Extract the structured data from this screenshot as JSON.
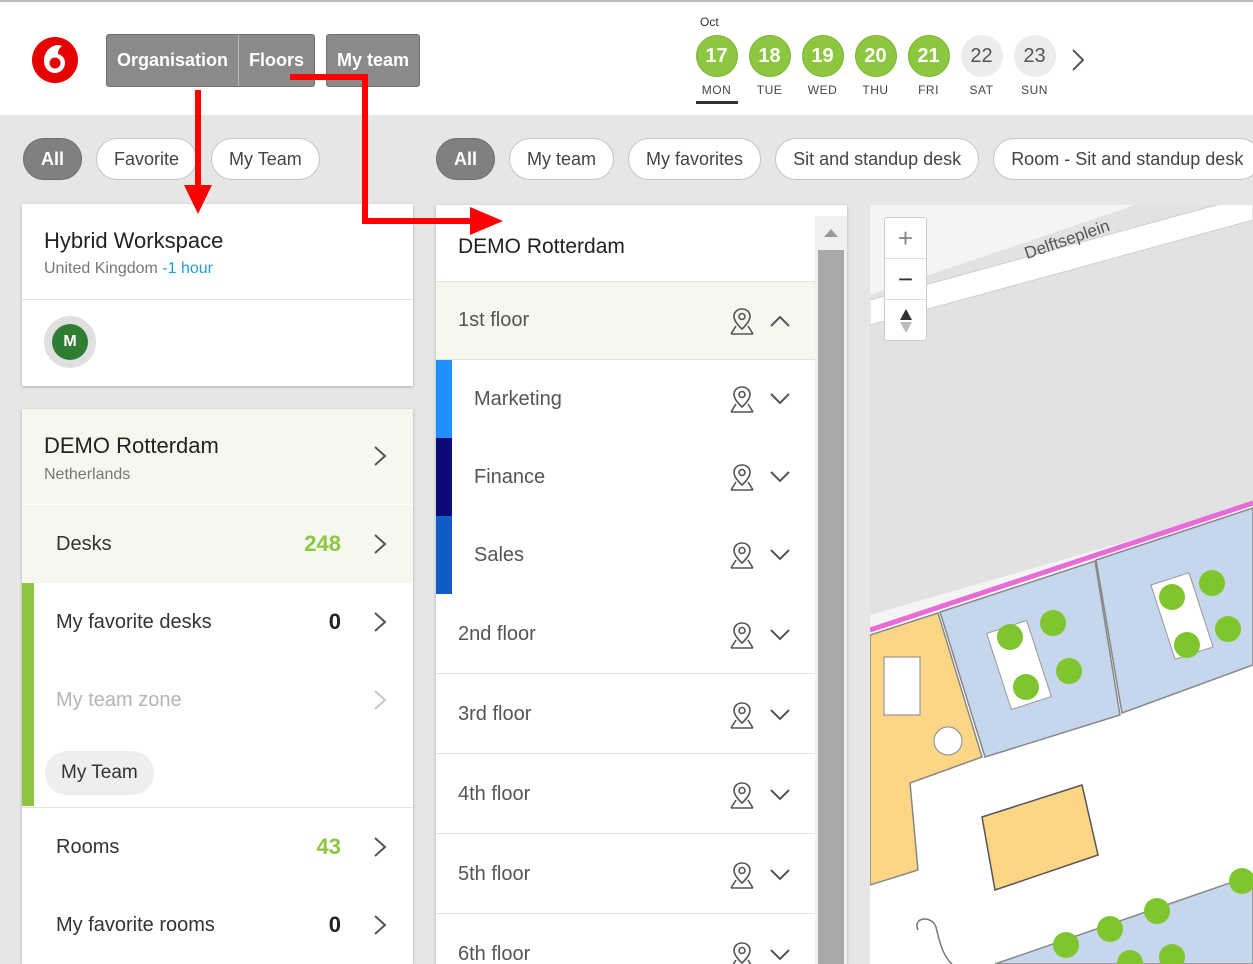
{
  "header": {
    "tabs_group1": [
      "Organisation",
      "Floors"
    ],
    "tabs_group2": [
      "My team"
    ],
    "month": "Oct",
    "days": [
      {
        "num": "17",
        "label": "MON",
        "state": "green",
        "selected": true
      },
      {
        "num": "18",
        "label": "TUE",
        "state": "green",
        "selected": false
      },
      {
        "num": "19",
        "label": "WED",
        "state": "green",
        "selected": false
      },
      {
        "num": "20",
        "label": "THU",
        "state": "green",
        "selected": false
      },
      {
        "num": "21",
        "label": "FRI",
        "state": "green",
        "selected": false
      },
      {
        "num": "22",
        "label": "SAT",
        "state": "grey",
        "selected": false
      },
      {
        "num": "23",
        "label": "SUN",
        "state": "grey",
        "selected": false
      }
    ],
    "next_icon": "chevron-right-icon"
  },
  "left_filters": [
    "All",
    "Favorite",
    "My Team"
  ],
  "floor_filters": [
    "All",
    "My team",
    "My favorites",
    "Sit and standup desk",
    "Room - Sit and standup desk"
  ],
  "workspace": {
    "title": "Hybrid Workspace",
    "country": "United Kingdom",
    "tz": "-1 hour",
    "avatar_letter": "M"
  },
  "location": {
    "title": "DEMO Rotterdam",
    "country": "Netherlands",
    "rows": [
      {
        "label": "Desks",
        "count": "248",
        "count_color": "#8dc63f"
      },
      {
        "label": "My favorite desks",
        "count": "0",
        "count_color": "#222222"
      },
      {
        "label": "My team zone",
        "count": "",
        "count_color": "#222222"
      },
      {
        "label": "Rooms",
        "count": "43",
        "count_color": "#8dc63f"
      },
      {
        "label": "My favorite rooms",
        "count": "0",
        "count_color": "#222222"
      }
    ],
    "team_chip": "My Team"
  },
  "floors": {
    "title": "DEMO Rotterdam",
    "items": [
      {
        "label": "1st floor",
        "expanded": true
      },
      {
        "label": "Marketing",
        "dept_color": "#1e90ff"
      },
      {
        "label": "Finance",
        "dept_color": "#0a0a7a"
      },
      {
        "label": "Sales",
        "dept_color": "#0f5cc4"
      },
      {
        "label": "2nd floor"
      },
      {
        "label": "3rd floor"
      },
      {
        "label": "4th floor"
      },
      {
        "label": "5th floor"
      },
      {
        "label": "6th floor"
      }
    ]
  },
  "map": {
    "street": "Delftseplein",
    "zoom_in": "+",
    "zoom_out": "−"
  },
  "colors": {
    "accent_green": "#8dc63f",
    "brand_red": "#e60000",
    "annotation_arrow": "#ff0000"
  }
}
